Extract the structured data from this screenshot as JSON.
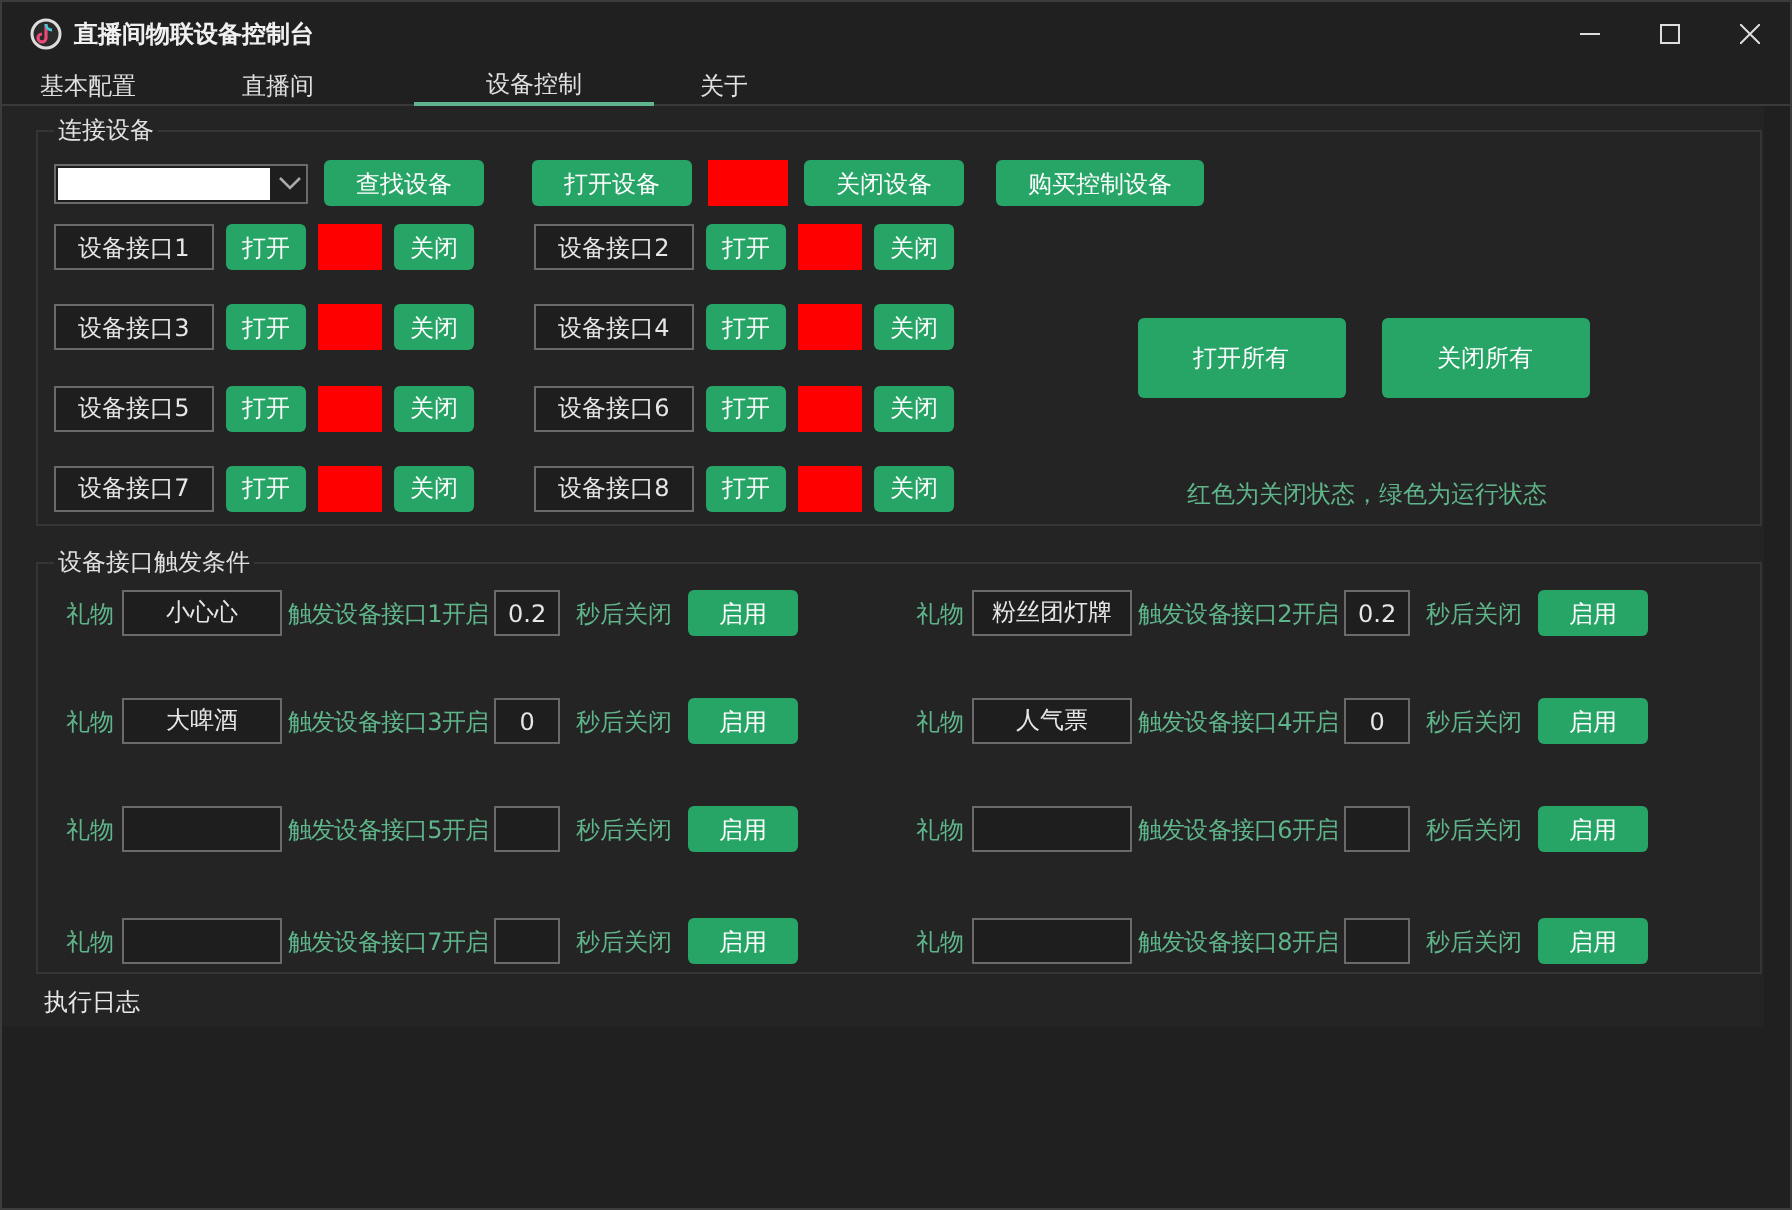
{
  "window": {
    "title": "直播间物联设备控制台"
  },
  "tabs": [
    {
      "label": "基本配置",
      "selected": false
    },
    {
      "label": "直播间",
      "selected": false
    },
    {
      "label": "设备控制",
      "selected": true
    },
    {
      "label": "关于",
      "selected": false
    }
  ],
  "connect_group": {
    "title": "连接设备",
    "find_button": "查找设备",
    "open_button": "打开设备",
    "device_on": false,
    "close_button": "关闭设备",
    "buy_button": "购买控制设备"
  },
  "ports": [
    {
      "label": "设备接口1",
      "open_button": "打开",
      "on": false,
      "close_button": "关闭"
    },
    {
      "label": "设备接口2",
      "open_button": "打开",
      "on": false,
      "close_button": "关闭"
    },
    {
      "label": "设备接口3",
      "open_button": "打开",
      "on": false,
      "close_button": "关闭"
    },
    {
      "label": "设备接口4",
      "open_button": "打开",
      "on": false,
      "close_button": "关闭"
    },
    {
      "label": "设备接口5",
      "open_button": "打开",
      "on": false,
      "close_button": "关闭"
    },
    {
      "label": "设备接口6",
      "open_button": "打开",
      "on": false,
      "close_button": "关闭"
    },
    {
      "label": "设备接口7",
      "open_button": "打开",
      "on": false,
      "close_button": "关闭"
    },
    {
      "label": "设备接口8",
      "open_button": "打开",
      "on": false,
      "close_button": "关闭"
    }
  ],
  "open_all_button": "打开所有",
  "close_all_button": "关闭所有",
  "legend": "红色为关闭状态，绿色为运行状态",
  "trigger_group": {
    "title": "设备接口触发条件",
    "rules": [
      {
        "gift_label": "礼物",
        "gift": "小心心",
        "trigger_text": "触发设备接口1开启",
        "seconds": "0.2",
        "after_text": "秒后关闭",
        "button": "启用"
      },
      {
        "gift_label": "礼物",
        "gift": "粉丝团灯牌",
        "trigger_text": "触发设备接口2开启",
        "seconds": "0.2",
        "after_text": "秒后关闭",
        "button": "启用"
      },
      {
        "gift_label": "礼物",
        "gift": "大啤酒",
        "trigger_text": "触发设备接口3开启",
        "seconds": "0",
        "after_text": "秒后关闭",
        "button": "启用"
      },
      {
        "gift_label": "礼物",
        "gift": "人气票",
        "trigger_text": "触发设备接口4开启",
        "seconds": "0",
        "after_text": "秒后关闭",
        "button": "启用"
      },
      {
        "gift_label": "礼物",
        "trigger_text": "触发设备接口5开启",
        "after_text": "秒后关闭",
        "button": "启用"
      },
      {
        "gift_label": "礼物",
        "trigger_text": "触发设备接口6开启",
        "after_text": "秒后关闭",
        "button": "启用"
      },
      {
        "gift_label": "礼物",
        "trigger_text": "触发设备接口7开启",
        "after_text": "秒后关闭",
        "button": "启用"
      },
      {
        "gift_label": "礼物",
        "trigger_text": "触发设备接口8开启",
        "after_text": "秒后关闭",
        "button": "启用"
      }
    ]
  },
  "log": {
    "title": "执行日志"
  }
}
